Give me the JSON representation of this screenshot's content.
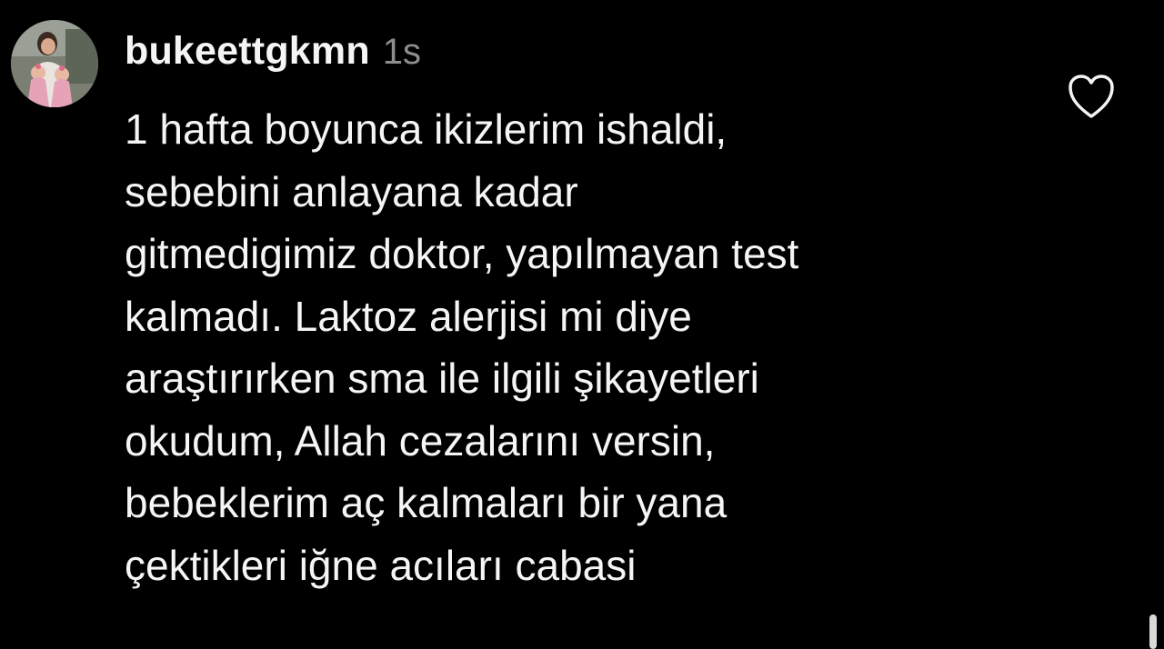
{
  "comment": {
    "avatar_icon": "profile-photo-avatar",
    "username": "bukeettgkmn",
    "timestamp": "1s",
    "text_lines": [
      "1 hafta boyunca ikizlerim ishaldi,",
      "sebebini anlayana kadar",
      "gitmedigimiz doktor, yapılmayan test",
      "kalmadı. Laktoz alerjisi mi diye",
      "araştırırken sma ile ilgili şikayetleri",
      "okudum, Allah cezalarını versin,",
      "bebeklerim aç kalmaları bir yana",
      "çektikleri iğne acıları cabasi"
    ],
    "like_icon": "heart-outline-icon"
  },
  "colors": {
    "background": "#000000",
    "text_primary": "#f5f5f5",
    "text_secondary": "#8e8e8e",
    "scrollbar": "#d9d9d9"
  }
}
